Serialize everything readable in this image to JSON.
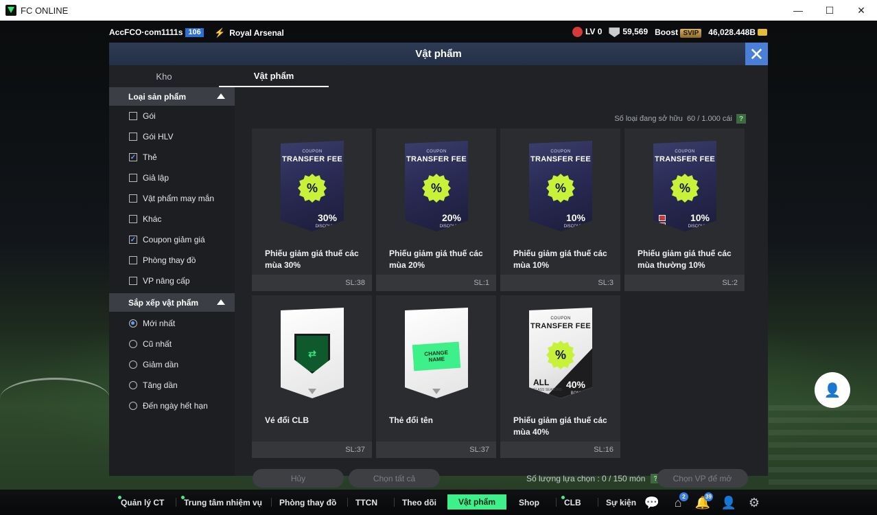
{
  "window": {
    "title": "FC ONLINE",
    "minimize": "—",
    "maximize": "☐",
    "close": "✕"
  },
  "topbar": {
    "account": "AccFCO·com1111s",
    "level": "106",
    "club": "Royal Arsenal",
    "lv": "LV 0",
    "points": "59,569",
    "boost": "Boost",
    "svip": "SVIP",
    "coins": "46,028.448B"
  },
  "modal": {
    "title": "Vật phẩm",
    "close": "✕",
    "tabs": [
      {
        "label": "Kho"
      },
      {
        "label": "Vật phẩm"
      }
    ],
    "owned_label": "Số loại đang sở hữu",
    "owned_value": "60 / 1.000 cái",
    "help": "?"
  },
  "filters": {
    "product_type": {
      "title": "Loại sản phẩm",
      "options": [
        {
          "label": "Gói",
          "checked": false
        },
        {
          "label": "Gói HLV",
          "checked": false
        },
        {
          "label": "Thẻ",
          "checked": true
        },
        {
          "label": "Giả lập",
          "checked": false
        },
        {
          "label": "Vật phẩm may mắn",
          "checked": false
        },
        {
          "label": "Khác",
          "checked": false
        },
        {
          "label": "Coupon giảm giá",
          "checked": true
        },
        {
          "label": "Phòng thay đồ",
          "checked": false
        },
        {
          "label": "VP nâng cấp",
          "checked": false
        }
      ]
    },
    "sort": {
      "title": "Sắp xếp vật phẩm",
      "options": [
        {
          "label": "Mới nhất",
          "selected": true
        },
        {
          "label": "Cũ nhất",
          "selected": false
        },
        {
          "label": "Giảm dần",
          "selected": false
        },
        {
          "label": "Tăng dần",
          "selected": false
        },
        {
          "label": "Đến ngày hết hạn",
          "selected": false
        }
      ]
    }
  },
  "items": [
    {
      "name": "Phiếu giảm giá thuế các mùa 30%",
      "qty": "SL:38",
      "art": "coupon-dark",
      "coupon_small": "COUPON",
      "coupon_title": "TRANSFER FEE",
      "pct": "%",
      "discount": "30%",
      "discount_small": "DISCOUNT"
    },
    {
      "name": "Phiếu giảm giá thuế các mùa 20%",
      "qty": "SL:1",
      "art": "coupon-dark",
      "coupon_small": "COUPON",
      "coupon_title": "TRANSFER FEE",
      "pct": "%",
      "discount": "20%",
      "discount_small": "DISCOUNT"
    },
    {
      "name": "Phiếu giảm giá thuế các mùa 10%",
      "qty": "SL:3",
      "art": "coupon-dark",
      "coupon_small": "COUPON",
      "coupon_title": "TRANSFER FEE",
      "pct": "%",
      "discount": "10%",
      "discount_small": "DISCOUNT"
    },
    {
      "name": "Phiếu giảm giá thuế các mùa thường 10%",
      "qty": "SL:2",
      "art": "coupon-dark-stamp",
      "coupon_small": "COUPON",
      "coupon_title": "TRANSFER FEE",
      "pct": "%",
      "discount": "10%",
      "discount_small": "DISCOUNT"
    },
    {
      "name": "Vé đổi CLB",
      "qty": "SL:37",
      "art": "club-ticket"
    },
    {
      "name": "Thẻ đổi tên",
      "qty": "SL:37",
      "art": "name-ticket",
      "ticket_text_1": "CHANGE",
      "ticket_text_2": "NAME"
    },
    {
      "name": "Phiếu giảm giá thuế các mùa 40%",
      "qty": "SL:16",
      "art": "coupon-white",
      "coupon_small": "COUPON",
      "coupon_title": "TRANSFER FEE",
      "pct": "%",
      "discount": "40%",
      "discount_small": "BONUS",
      "all_label": "ALL",
      "all_small": "CLASS SEASONS"
    }
  ],
  "actions": {
    "cancel": "Hủy",
    "select_all": "Chọn tất cả",
    "selection_label": "Số lượng lựa chọn : 0 / 150 món",
    "help": "?",
    "choose": "Chọn VP để mở"
  },
  "bottom_nav": [
    {
      "label": "Quản lý CT",
      "dot": true
    },
    {
      "label": "Trung tâm nhiệm vụ",
      "dot": true
    },
    {
      "label": "Phòng thay đồ",
      "dot": false
    },
    {
      "label": "TTCN",
      "dot": false
    },
    {
      "label": "Theo dõi",
      "dot": false
    },
    {
      "label": "Vật phẩm",
      "dot": false,
      "active": true
    },
    {
      "label": "Shop",
      "dot": false
    },
    {
      "label": "CLB",
      "dot": true
    },
    {
      "label": "Sự kiện",
      "dot": false
    }
  ],
  "nav_icons": {
    "chat": "💬",
    "home": "⌂",
    "home_badge": "2",
    "bell": "🔔",
    "bell_badge": "39",
    "profile": "👤",
    "settings": "⚙"
  },
  "colors": {
    "accent_green": "#3ef08a",
    "header_blue": "#4a7fd8",
    "panel": "#202225"
  }
}
